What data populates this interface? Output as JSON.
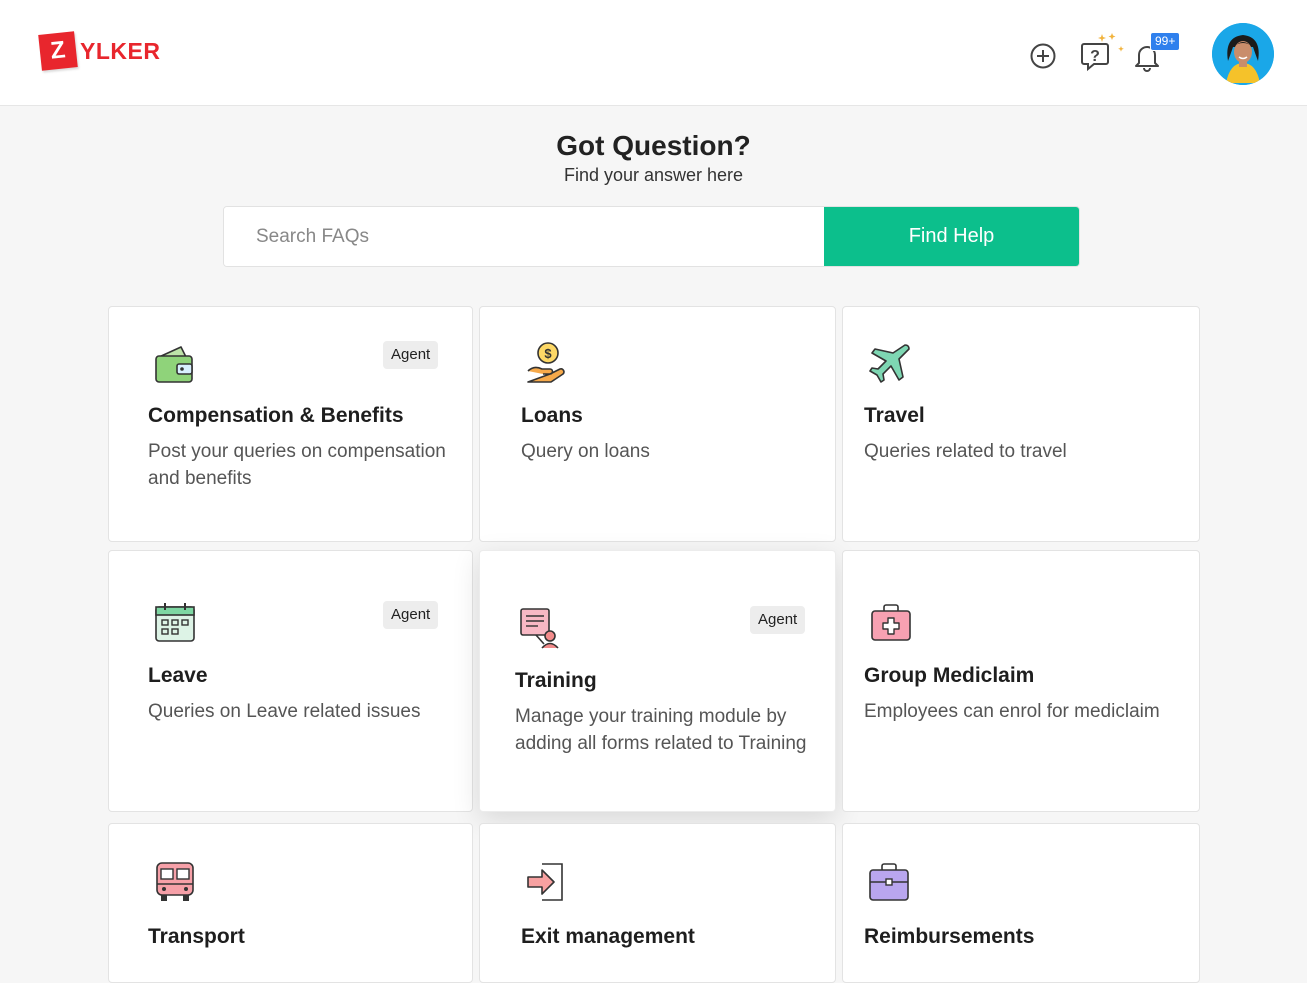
{
  "app": {
    "logo_letter": "Z",
    "logo_text": "YLKER"
  },
  "header": {
    "icons": [
      "add-icon",
      "faq-sparkle-icon",
      "bell-icon"
    ],
    "notification_badge": "99+"
  },
  "hero": {
    "title": "Got Question?",
    "subtitle": "Find your answer here"
  },
  "search": {
    "placeholder": "Search FAQs",
    "value": "",
    "button_label": "Find Help"
  },
  "colors": {
    "brand": "#e8262d",
    "accent": "#0cbf8c",
    "badge": "#2f80ed"
  },
  "categories": [
    {
      "icon": "wallet-icon",
      "title": "Compensation & Benefits",
      "desc1": "Post your queries on compensation",
      "desc2": "and benefits",
      "badge": "Agent"
    },
    {
      "icon": "loan-hand-icon",
      "title": "Loans",
      "desc1": "Query on loans",
      "desc2": "",
      "badge": ""
    },
    {
      "icon": "airplane-icon",
      "title": "Travel",
      "desc1": "Queries related to travel",
      "desc2": "",
      "badge": ""
    },
    {
      "icon": "calendar-icon",
      "title": "Leave",
      "desc1": "Queries on Leave related issues",
      "desc2": "",
      "badge": "Agent"
    },
    {
      "icon": "training-icon",
      "title": "Training",
      "desc1": "Manage your training module by",
      "desc2": "adding all forms related to Training",
      "badge": "Agent"
    },
    {
      "icon": "medical-kit-icon",
      "title": "Group Mediclaim",
      "desc1": "Employees can enrol for mediclaim",
      "desc2": "",
      "badge": ""
    },
    {
      "icon": "bus-icon",
      "title": "Transport",
      "desc1": "",
      "desc2": "",
      "badge": ""
    },
    {
      "icon": "exit-door-icon",
      "title": "Exit management",
      "desc1": "",
      "desc2": "",
      "badge": ""
    },
    {
      "icon": "briefcase-icon",
      "title": "Reimbursements",
      "desc1": "",
      "desc2": "",
      "badge": ""
    }
  ]
}
